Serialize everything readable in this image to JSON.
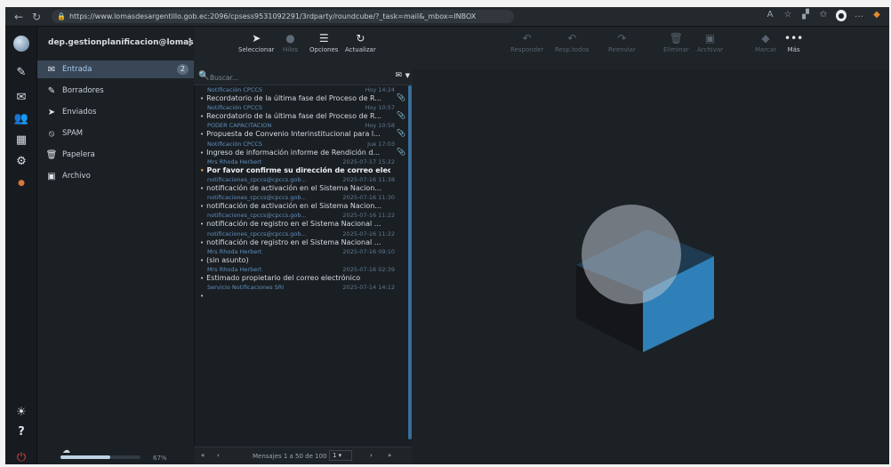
{
  "browser": {
    "url": "https://www.lomasdesargentillo.gob.ec:2096/cpsess9531092291/3rdparty/roundcube/?_task=mail&_mbox=INBOX"
  },
  "account": {
    "name": "dep.gestionplanificacion@lomasde...",
    "menu": "⋮"
  },
  "folders": [
    {
      "label": "Entrada",
      "icon": "inbox-icon",
      "glyph": "✉",
      "badge": "2",
      "active": true
    },
    {
      "label": "Borradores",
      "icon": "pencil-icon",
      "glyph": "✎"
    },
    {
      "label": "Enviados",
      "icon": "send-icon",
      "glyph": "➤"
    },
    {
      "label": "SPAM",
      "icon": "spam-icon",
      "glyph": "⦸"
    },
    {
      "label": "Papelera",
      "icon": "trash-icon",
      "glyph": "🗑"
    },
    {
      "label": "Archivo",
      "icon": "archive-icon",
      "glyph": "▣"
    }
  ],
  "list_toolbar": {
    "select": "Seleccionar",
    "threads": "Hilos",
    "options": "Opciones",
    "refresh": "Actualizar"
  },
  "search": {
    "placeholder": "Buscar..."
  },
  "messages": [
    {
      "from": "Notificación CPCCS",
      "date": "Hoy 14:24",
      "subject": "Recordatorio de la última fase del Proceso de R...",
      "unread": false,
      "attachment": true
    },
    {
      "from": "Notificación CPCCS",
      "date": "Hoy 10:57",
      "subject": "Recordatorio de la última fase del Proceso de R...",
      "unread": false,
      "attachment": true
    },
    {
      "from": "PODER CAPACITACION",
      "date": "Hoy 10:58",
      "subject": "Propuesta de Convenio Interinstitucional para l...",
      "unread": false,
      "attachment": true
    },
    {
      "from": "Notificación CPCCS",
      "date": "Jue 17:03",
      "subject": "Ingreso de información informe de Rendición d...",
      "unread": false,
      "attachment": true
    },
    {
      "from": "Mrs Rhoda Herbert",
      "date": "2025-07-17 15:22",
      "subject": "Por favor confirme su dirección de correo elec...",
      "unread": true,
      "attachment": false
    },
    {
      "from": "notificaciones_cpccs@cpccs.gob...",
      "date": "2025-07-16 11:38",
      "subject": "notificación de activación en el Sistema Nacion...",
      "unread": false,
      "attachment": false
    },
    {
      "from": "notificaciones_cpccs@cpccs.gob...",
      "date": "2025-07-16 11:30",
      "subject": "notificación de activación en el Sistema Nacion...",
      "unread": false,
      "attachment": false
    },
    {
      "from": "notificaciones_cpccs@cpccs.gob...",
      "date": "2025-07-16 11:22",
      "subject": "notificación de registro en el Sistema Nacional ...",
      "unread": false,
      "attachment": false
    },
    {
      "from": "notificaciones_cpccs@cpccs.gob...",
      "date": "2025-07-16 11:22",
      "subject": "notificación de registro en el Sistema Nacional ...",
      "unread": false,
      "attachment": false
    },
    {
      "from": "Mrs Rhoda Herbert",
      "date": "2025-07-16 09:10",
      "subject": "(sin asunto)",
      "unread": false,
      "attachment": false
    },
    {
      "from": "Mrs Rhoda Herbert",
      "date": "2025-07-16 02:39",
      "subject": "Estimado propietario del correo electrónico",
      "unread": false,
      "attachment": false
    },
    {
      "from": "Servicio Notificaciones SRI",
      "date": "2025-07-14 14:12",
      "subject": "",
      "unread": false,
      "attachment": false
    }
  ],
  "pager": {
    "first": "«",
    "prev": "‹",
    "text": "Mensajes 1 a 50 de 100",
    "next": "›",
    "last": "»"
  },
  "quota": {
    "percent": "67%",
    "fraction": 0.62
  },
  "reading_toolbar": {
    "reply": "Responder",
    "reply_all": "Resp.todos",
    "forward": "Reenviar",
    "delete": "Eliminar",
    "archive": "Archivar",
    "mark": "Marcar",
    "more": "Más"
  }
}
